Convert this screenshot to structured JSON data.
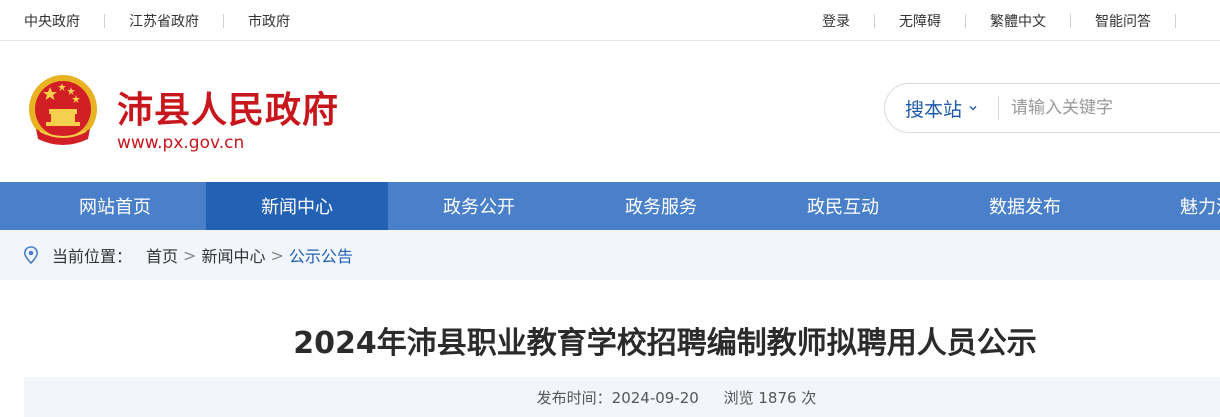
{
  "topbar": {
    "left_links": [
      "中央政府",
      "江苏省政府",
      "市政府"
    ],
    "right_links": [
      "登录",
      "无障碍",
      "繁體中文",
      "智能问答"
    ]
  },
  "header": {
    "site_name": "沛县人民政府",
    "site_url": "www.px.gov.cn",
    "emblem_icon": "national-emblem-icon",
    "brand_color": "#c8161d"
  },
  "search": {
    "scope_label": "搜本站",
    "placeholder": "请输入关键字"
  },
  "nav": {
    "items": [
      "网站首页",
      "新闻中心",
      "政务公开",
      "政务服务",
      "政民互动",
      "数据发布",
      "魅力沛"
    ],
    "active_index": 1,
    "bar_color": "#4a80c9",
    "active_color": "#2361b5"
  },
  "breadcrumb": {
    "prefix": "当前位置：",
    "items": [
      "首页",
      "新闻中心",
      "公示公告"
    ],
    "separator": ">"
  },
  "article": {
    "title": "2024年沛县职业教育学校招聘编制教师拟聘用人员公示",
    "publish_label": "发布时间：2024-09-20",
    "views_label": "浏览 1876 次"
  }
}
